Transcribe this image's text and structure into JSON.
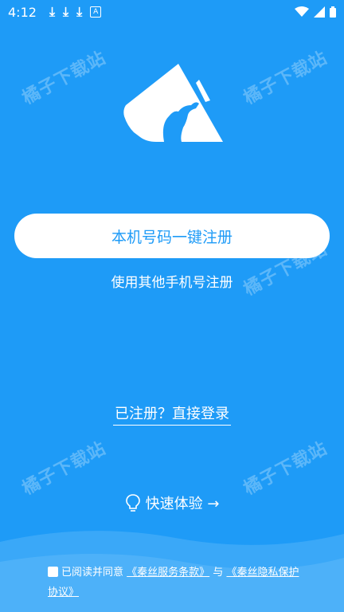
{
  "status_bar": {
    "time": "4:12",
    "icons": [
      "download-icon",
      "download-icon",
      "download-icon",
      "a-box-icon",
      "wifi-icon",
      "signal-icon",
      "battery-icon"
    ]
  },
  "watermark": "橘子下载站",
  "buttons": {
    "one_click_register": "本机号码一键注册",
    "other_register": "使用其他手机号注册",
    "login": "已注册？直接登录",
    "quick_experience": "快速体验 →"
  },
  "agreement": {
    "prefix": "已阅读并同意",
    "service_terms": "《秦丝服务条款》",
    "and": " 与 ",
    "privacy_policy": "《秦丝隐私保护协议》"
  },
  "colors": {
    "background": "#1e9bf7",
    "button_text": "#1e9bf7",
    "white": "#ffffff"
  }
}
